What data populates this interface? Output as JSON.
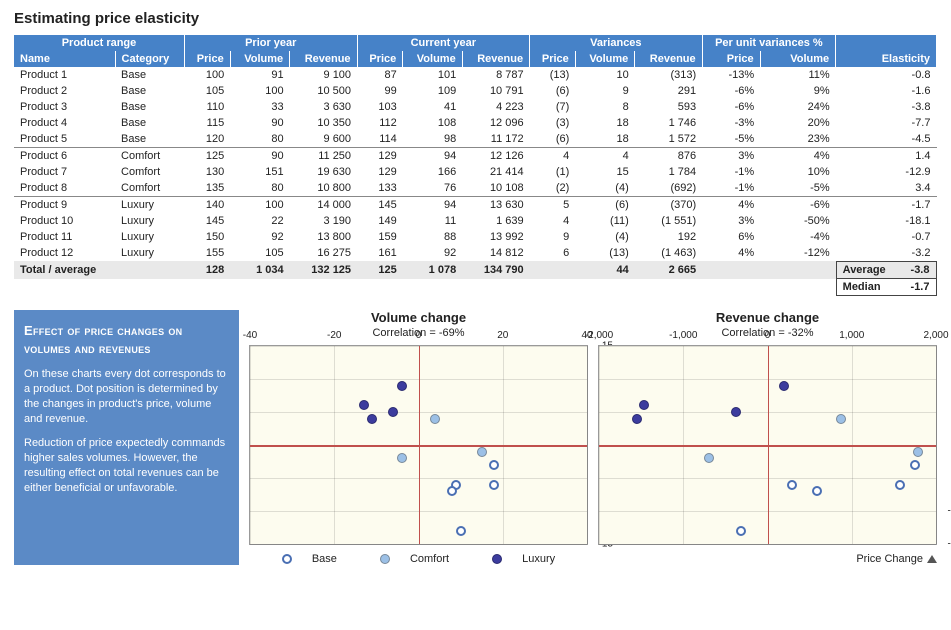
{
  "title": "Estimating price elasticity",
  "groups": [
    "Product range",
    "Prior year",
    "Current year",
    "Variances",
    "Per unit variances %",
    ""
  ],
  "cols": [
    "Name",
    "Category",
    "Price",
    "Volume",
    "Revenue",
    "Price",
    "Volume",
    "Revenue",
    "Price",
    "Volume",
    "Revenue",
    "Price",
    "Volume",
    "Elasticity"
  ],
  "rows": [
    {
      "n": "Product 1",
      "c": "Base",
      "pp": "100",
      "pv": "91",
      "pr": "9 100",
      "cp": "87",
      "cv": "101",
      "cr": "8 787",
      "vp": "(13)",
      "vv": "10",
      "vr": "(313)",
      "up": "-13%",
      "uv": "11%",
      "e": "-0.8"
    },
    {
      "n": "Product 2",
      "c": "Base",
      "pp": "105",
      "pv": "100",
      "pr": "10 500",
      "cp": "99",
      "cv": "109",
      "cr": "10 791",
      "vp": "(6)",
      "vv": "9",
      "vr": "291",
      "up": "-6%",
      "uv": "9%",
      "e": "-1.6"
    },
    {
      "n": "Product 3",
      "c": "Base",
      "pp": "110",
      "pv": "33",
      "pr": "3 630",
      "cp": "103",
      "cv": "41",
      "cr": "4 223",
      "vp": "(7)",
      "vv": "8",
      "vr": "593",
      "up": "-6%",
      "uv": "24%",
      "e": "-3.8"
    },
    {
      "n": "Product 4",
      "c": "Base",
      "pp": "115",
      "pv": "90",
      "pr": "10 350",
      "cp": "112",
      "cv": "108",
      "cr": "12 096",
      "vp": "(3)",
      "vv": "18",
      "vr": "1 746",
      "up": "-3%",
      "uv": "20%",
      "e": "-7.7"
    },
    {
      "n": "Product 5",
      "c": "Base",
      "pp": "120",
      "pv": "80",
      "pr": "9 600",
      "cp": "114",
      "cv": "98",
      "cr": "11 172",
      "vp": "(6)",
      "vv": "18",
      "vr": "1 572",
      "up": "-5%",
      "uv": "23%",
      "e": "-4.5"
    },
    {
      "n": "Product 6",
      "c": "Comfort",
      "pp": "125",
      "pv": "90",
      "pr": "11 250",
      "cp": "129",
      "cv": "94",
      "cr": "12 126",
      "vp": "4",
      "vv": "4",
      "vr": "876",
      "up": "3%",
      "uv": "4%",
      "e": "1.4"
    },
    {
      "n": "Product 7",
      "c": "Comfort",
      "pp": "130",
      "pv": "151",
      "pr": "19 630",
      "cp": "129",
      "cv": "166",
      "cr": "21 414",
      "vp": "(1)",
      "vv": "15",
      "vr": "1 784",
      "up": "-1%",
      "uv": "10%",
      "e": "-12.9"
    },
    {
      "n": "Product 8",
      "c": "Comfort",
      "pp": "135",
      "pv": "80",
      "pr": "10 800",
      "cp": "133",
      "cv": "76",
      "cr": "10 108",
      "vp": "(2)",
      "vv": "(4)",
      "vr": "(692)",
      "up": "-1%",
      "uv": "-5%",
      "e": "3.4"
    },
    {
      "n": "Product 9",
      "c": "Luxury",
      "pp": "140",
      "pv": "100",
      "pr": "14 000",
      "cp": "145",
      "cv": "94",
      "cr": "13 630",
      "vp": "5",
      "vv": "(6)",
      "vr": "(370)",
      "up": "4%",
      "uv": "-6%",
      "e": "-1.7"
    },
    {
      "n": "Product 10",
      "c": "Luxury",
      "pp": "145",
      "pv": "22",
      "pr": "3 190",
      "cp": "149",
      "cv": "11",
      "cr": "1 639",
      "vp": "4",
      "vv": "(11)",
      "vr": "(1 551)",
      "up": "3%",
      "uv": "-50%",
      "e": "-18.1"
    },
    {
      "n": "Product 11",
      "c": "Luxury",
      "pp": "150",
      "pv": "92",
      "pr": "13 800",
      "cp": "159",
      "cv": "88",
      "cr": "13 992",
      "vp": "9",
      "vv": "(4)",
      "vr": "192",
      "up": "6%",
      "uv": "-4%",
      "e": "-0.7"
    },
    {
      "n": "Product 12",
      "c": "Luxury",
      "pp": "155",
      "pv": "105",
      "pr": "16 275",
      "cp": "161",
      "cv": "92",
      "cr": "14 812",
      "vp": "6",
      "vv": "(13)",
      "vr": "(1 463)",
      "up": "4%",
      "uv": "-12%",
      "e": "-3.2"
    }
  ],
  "total": {
    "label": "Total / average",
    "pp": "128",
    "pv": "1 034",
    "pr": "132 125",
    "cp": "125",
    "cv": "1 078",
    "cr": "134 790",
    "vp": "",
    "vv": "44",
    "vr": "2 665"
  },
  "summary": {
    "avg_label": "Average",
    "avg_val": "-3.8",
    "med_label": "Median",
    "med_val": "-1.7"
  },
  "sidebar": {
    "heading": "Effect of price changes on volumes and revenues",
    "p1": "On these charts every dot corresponds to a product. Dot position is determined by the changes in product's price, volume and revenue.",
    "p2": "Reduction of price expectedly commands higher sales volumes. However, the resulting effect on total revenues  can be either beneficial or unfavorable."
  },
  "legend": {
    "base": "Base",
    "comfort": "Comfort",
    "luxury": "Luxury",
    "pchg": "Price Change"
  },
  "chart_data": [
    {
      "type": "scatter",
      "title": "Volume change",
      "subtitle": "Correlation = -69%",
      "xlabel": "",
      "ylabel": "",
      "xlim": [
        -40,
        40
      ],
      "ylim": [
        -15,
        15
      ],
      "xticks": [
        -40,
        -20,
        0,
        20,
        40
      ],
      "yticks": [
        -15,
        -10,
        -5,
        0,
        5,
        10,
        15
      ],
      "series": [
        {
          "name": "Base",
          "points": [
            [
              10,
              -13
            ],
            [
              9,
              -6
            ],
            [
              8,
              -7
            ],
            [
              18,
              -3
            ],
            [
              18,
              -6
            ]
          ]
        },
        {
          "name": "Comfort",
          "points": [
            [
              4,
              4
            ],
            [
              15,
              -1
            ],
            [
              -4,
              -2
            ]
          ]
        },
        {
          "name": "Luxury",
          "points": [
            [
              -6,
              5
            ],
            [
              -11,
              4
            ],
            [
              -4,
              9
            ],
            [
              -13,
              6
            ]
          ]
        }
      ]
    },
    {
      "type": "scatter",
      "title": "Revenue change",
      "subtitle": "Correlation = -32%",
      "xlabel": "",
      "ylabel": "",
      "xlim": [
        -2000,
        2000
      ],
      "ylim": [
        -15,
        15
      ],
      "xticks": [
        -2000,
        -1000,
        0,
        1000,
        2000
      ],
      "yticks": [
        -15,
        -10,
        -5,
        0,
        5,
        10,
        15
      ],
      "series": [
        {
          "name": "Base",
          "points": [
            [
              -313,
              -13
            ],
            [
              291,
              -6
            ],
            [
              593,
              -7
            ],
            [
              1746,
              -3
            ],
            [
              1572,
              -6
            ]
          ]
        },
        {
          "name": "Comfort",
          "points": [
            [
              876,
              4
            ],
            [
              1784,
              -1
            ],
            [
              -692,
              -2
            ]
          ]
        },
        {
          "name": "Luxury",
          "points": [
            [
              -370,
              5
            ],
            [
              -1551,
              4
            ],
            [
              192,
              9
            ],
            [
              -1463,
              6
            ]
          ]
        }
      ]
    }
  ]
}
